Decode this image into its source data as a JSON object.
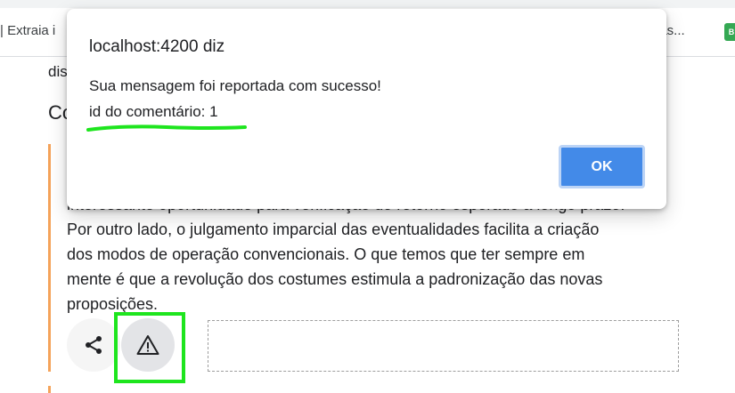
{
  "bookmarks": {
    "left_item": "| Extraia i",
    "right_item": "ias...",
    "favicon_text": "B"
  },
  "page": {
    "top_snippet": "dis",
    "section_heading": "Co",
    "comment_lines": [
      "interessante oportunidade para verificação do retorno esperado a longo prazo.",
      "Por outro lado, o julgamento imparcial das eventualidades facilita a criação",
      "dos modos de operação convencionais. O que temos que ter sempre em",
      "mente é que a revolução dos costumes estimula a padronização das novas",
      "proposições."
    ]
  },
  "actions": {
    "share_icon": "share-icon",
    "report_icon": "warning-icon"
  },
  "dialog": {
    "title": "localhost:4200 diz",
    "message_line1": "Sua mensagem foi reportada com sucesso!",
    "message_line2": "id do comentário: 1",
    "ok_label": "OK"
  },
  "colors": {
    "accent_bar": "#f5a35a",
    "highlight_annotation": "#1ee51e",
    "ok_button": "#438ae8"
  }
}
